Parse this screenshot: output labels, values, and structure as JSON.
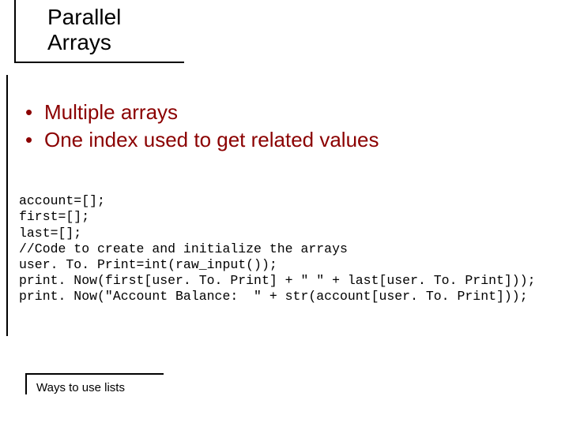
{
  "title": {
    "line1": "Parallel",
    "line2": "Arrays"
  },
  "bullets": [
    "Multiple arrays",
    "One index used to get related values"
  ],
  "code": [
    "account=[];",
    "first=[];",
    "last=[];",
    "//Code to create and initialize the arrays",
    "user. To. Print=int(raw_input());",
    "print. Now(first[user. To. Print] + \" \" + last[user. To. Print]));",
    "print. Now(\"Account Balance:  \" + str(account[user. To. Print]));"
  ],
  "footer": "Ways to use lists"
}
